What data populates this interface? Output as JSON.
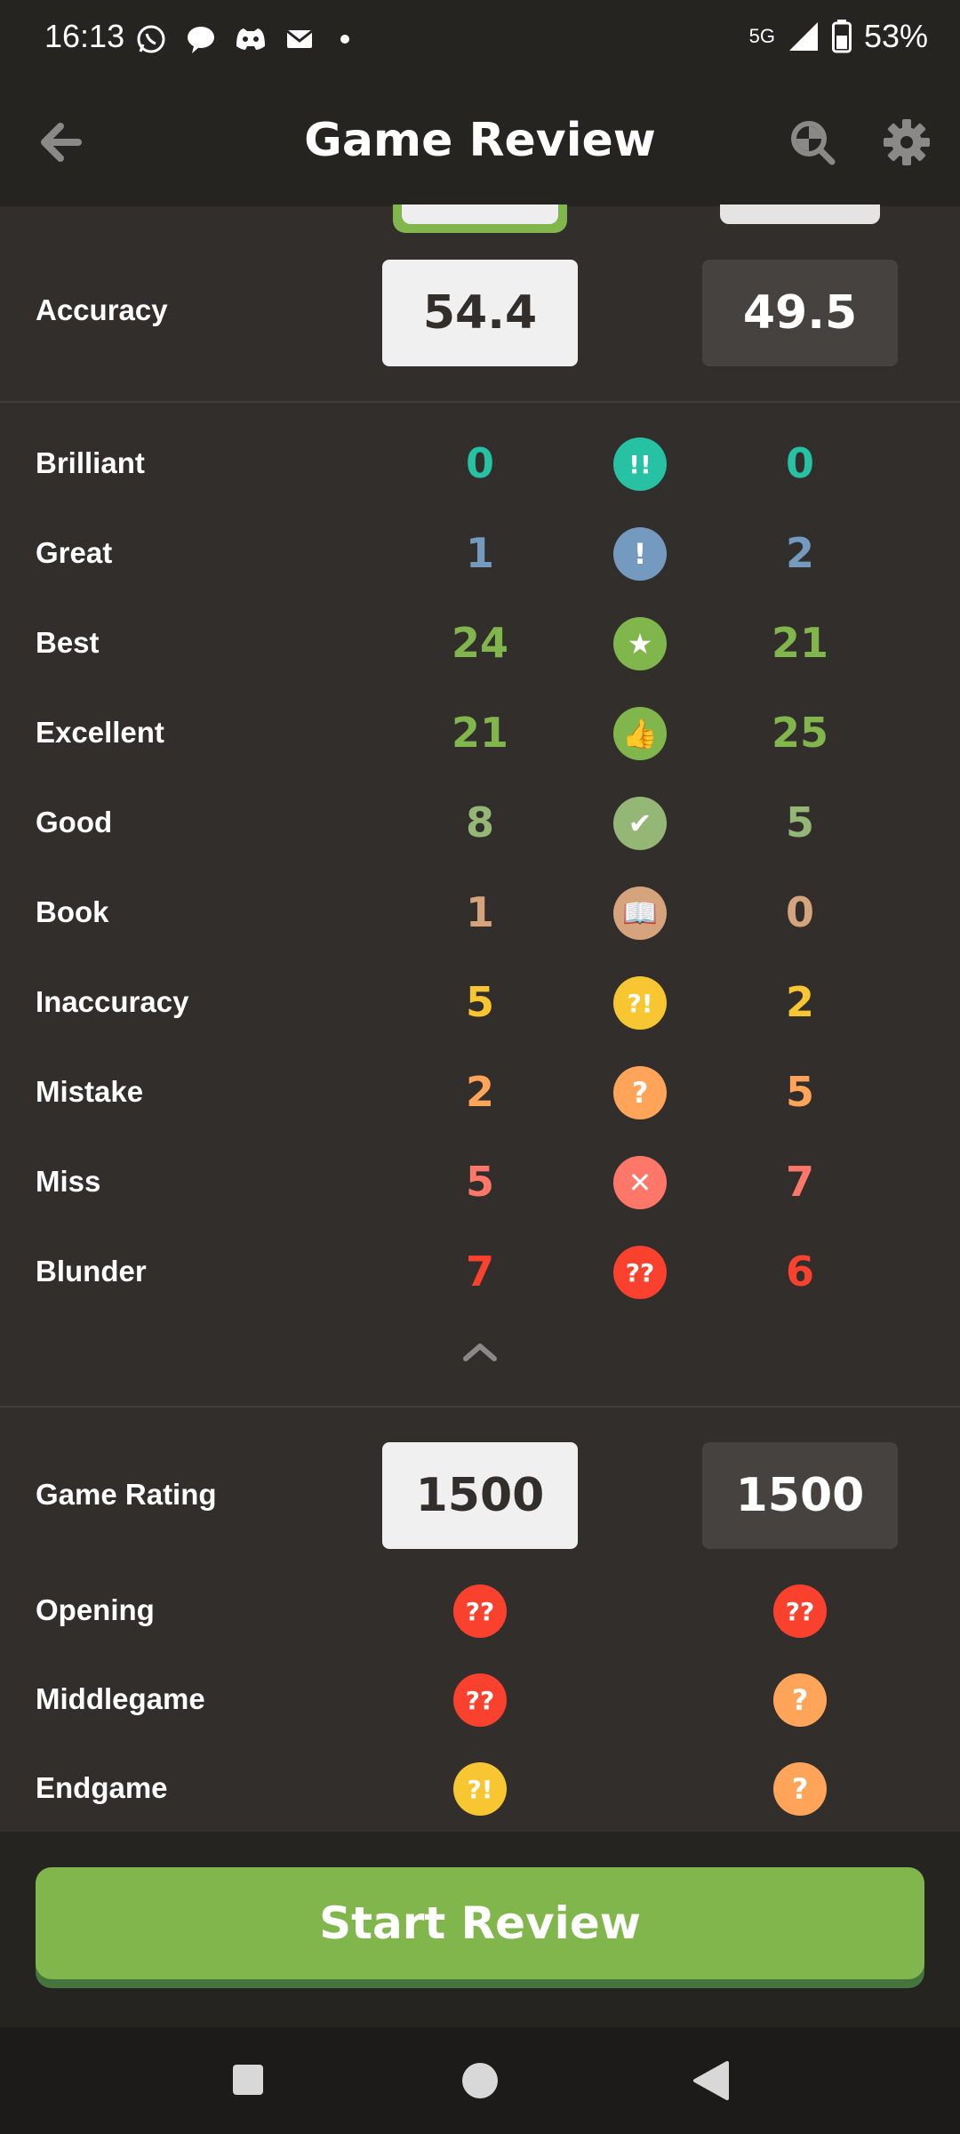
{
  "status_bar": {
    "time": "16:13",
    "network": "5G",
    "battery": "53%"
  },
  "header": {
    "title": "Game Review"
  },
  "accuracy": {
    "label": "Accuracy",
    "white": "54.4",
    "black": "49.5"
  },
  "moves": [
    {
      "label": "Brilliant",
      "white": "0",
      "black": "0",
      "icon": "brilliant-icon",
      "symbol": "!!",
      "color": "#26c2a3"
    },
    {
      "label": "Great",
      "white": "1",
      "black": "2",
      "icon": "great-icon",
      "symbol": "!",
      "color": "#749bbf"
    },
    {
      "label": "Best",
      "white": "24",
      "black": "21",
      "icon": "best-star-icon",
      "symbol": "★",
      "color": "#81b64c"
    },
    {
      "label": "Excellent",
      "white": "21",
      "black": "25",
      "icon": "excellent-thumb-icon",
      "symbol": "👍",
      "color": "#81b64c"
    },
    {
      "label": "Good",
      "white": "8",
      "black": "5",
      "icon": "good-check-icon",
      "symbol": "✔",
      "color": "#95b776"
    },
    {
      "label": "Book",
      "white": "1",
      "black": "0",
      "icon": "book-icon",
      "symbol": "📖",
      "color": "#d5a47d"
    },
    {
      "label": "Inaccuracy",
      "white": "5",
      "black": "2",
      "icon": "inaccuracy-icon",
      "symbol": "?!",
      "color": "#f7c631"
    },
    {
      "label": "Mistake",
      "white": "2",
      "black": "5",
      "icon": "mistake-icon",
      "symbol": "?",
      "color": "#ffa459"
    },
    {
      "label": "Miss",
      "white": "5",
      "black": "7",
      "icon": "miss-icon",
      "symbol": "✕",
      "color": "#ff7769"
    },
    {
      "label": "Blunder",
      "white": "7",
      "black": "6",
      "icon": "blunder-icon",
      "symbol": "??",
      "color": "#fa412d"
    }
  ],
  "game_rating": {
    "label": "Game Rating",
    "white": "1500",
    "black": "1500"
  },
  "phases": [
    {
      "label": "Opening",
      "white_symbol": "??",
      "white_icon": "blunder-icon",
      "white_color": "#fa412d",
      "black_symbol": "??",
      "black_icon": "blunder-icon",
      "black_color": "#fa412d"
    },
    {
      "label": "Middlegame",
      "white_symbol": "??",
      "white_icon": "blunder-icon",
      "white_color": "#fa412d",
      "black_symbol": "?",
      "black_icon": "mistake-icon",
      "black_color": "#ffa459"
    },
    {
      "label": "Endgame",
      "white_symbol": "?!",
      "white_icon": "inaccuracy-icon",
      "white_color": "#f7c631",
      "black_symbol": "?",
      "black_icon": "mistake-icon",
      "black_color": "#ffa459"
    }
  ],
  "actions": {
    "start_review": "Start Review"
  },
  "colors": {
    "background": "#312e2b",
    "bar": "#262421",
    "accent_green": "#81b64c"
  }
}
